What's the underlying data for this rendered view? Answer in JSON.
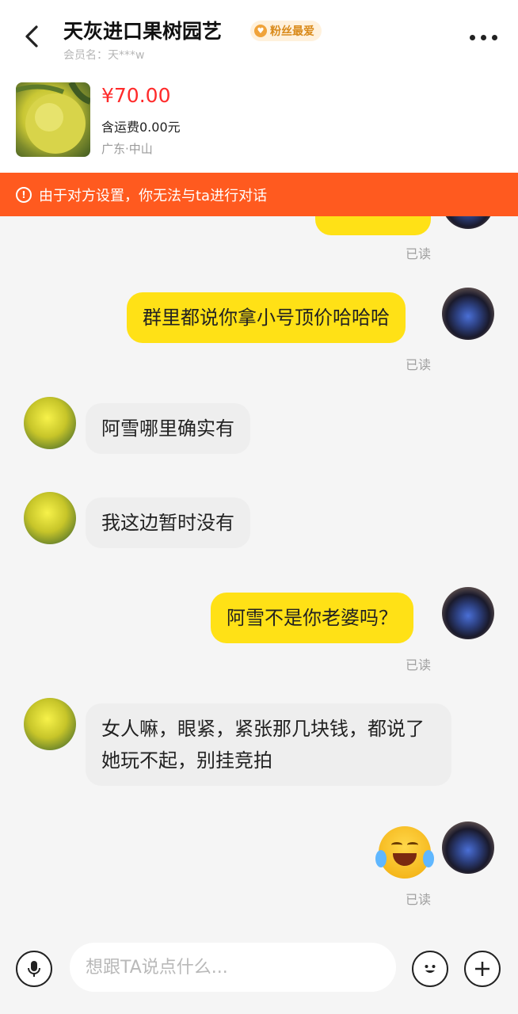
{
  "header": {
    "shop_name": "天灰进口果树园艺",
    "badge": "粉丝最爱",
    "member": "会员名：天***w"
  },
  "product": {
    "price": "¥70.00",
    "shipping": "含运费0.00元",
    "location": "广东·中山"
  },
  "banner": {
    "text": "由于对方设置，你无法与ta进行对话"
  },
  "messages": [
    {
      "from": "me",
      "text": "群里都说你拿小号顶价哈哈哈",
      "status": "已读"
    },
    {
      "from": "them",
      "text": "阿雪哪里确实有"
    },
    {
      "from": "them",
      "text": "我这边暂时没有"
    },
    {
      "from": "me",
      "text": "阿雪不是你老婆吗？",
      "status": "已读"
    },
    {
      "from": "them",
      "text": "女人嘛，眼紧，紧张那几块钱，都说了她玩不起，别挂竞拍"
    },
    {
      "from": "me",
      "type": "emoji",
      "emoji": "laughing-tears",
      "status": "已读"
    }
  ],
  "earlier_status": "已读",
  "input": {
    "placeholder": "想跟TA说点什么..."
  },
  "colors": {
    "banner": "#ff5a1f",
    "my_bubble": "#ffe116",
    "their_bubble": "#eeeeee",
    "price": "#ff2a2a"
  }
}
